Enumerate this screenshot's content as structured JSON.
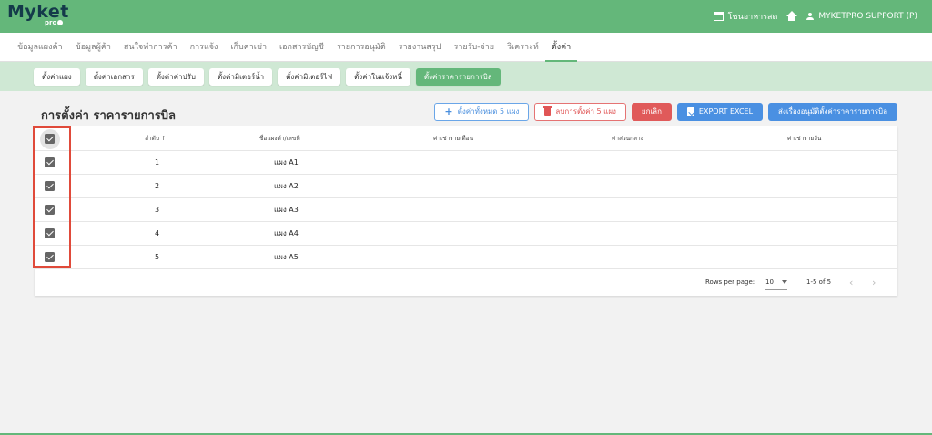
{
  "app": {
    "logo": "Myket",
    "logo_sub": "pro"
  },
  "topbar": {
    "store_name": "โชนอาหารสด",
    "user": "MYKETPRO SUPPORT (P)"
  },
  "main_tabs": [
    "ข้อมูลแผงค้า",
    "ข้อมูลผู้ค้า",
    "สนใจทำการค้า",
    "การแจ้ง",
    "เก็บค่าเช่า",
    "เอกสารบัญชี",
    "รายการอนุมัติ",
    "รายงานสรุป",
    "รายรับ-จ่าย",
    "วิเคราะห์",
    "ตั้งค่า"
  ],
  "sub_tabs": [
    "ตั้งค่าแผง",
    "ตั้งค่าเอกสาร",
    "ตั้งค่าค่าปรับ",
    "ตั้งค่ามิเตอร์น้ำ",
    "ตั้งค่ามิเตอร์ไฟ",
    "ตั้งค่าในแจ้งหนี้",
    "ตั้งค่าราคารายการบิล"
  ],
  "page_title": "การตั้งค่า ราคารายการบิล",
  "actions": {
    "set_all": "ตั้งค่าทั้งหมด 5 แผง",
    "delete_settings": "ลบการตั้งค่า 5 แผง",
    "cancel": "ยกเลิก",
    "export": "EXPORT EXCEL",
    "submit": "ส่งเรื่องอนุมัติตั้งค่าราคารายการบิล"
  },
  "table": {
    "headers": {
      "order": "ลำดับ ↑",
      "stall": "ชื่อแผงค้า/เลขที่",
      "monthly": "ค่าเช่ารายเดือน",
      "common": "ค่าส่วนกลาง",
      "daily": "ค่าเช่ารายวัน"
    },
    "rows": [
      {
        "order": "1",
        "stall": "แผง A1"
      },
      {
        "order": "2",
        "stall": "แผง A2"
      },
      {
        "order": "3",
        "stall": "แผง A3"
      },
      {
        "order": "4",
        "stall": "แผง A4"
      },
      {
        "order": "5",
        "stall": "แผง A5"
      }
    ]
  },
  "pagination": {
    "rows_per_page_label": "Rows per page:",
    "rows_per_page": "10",
    "range": "1-5 of 5",
    "prev": "‹",
    "next": "›"
  }
}
